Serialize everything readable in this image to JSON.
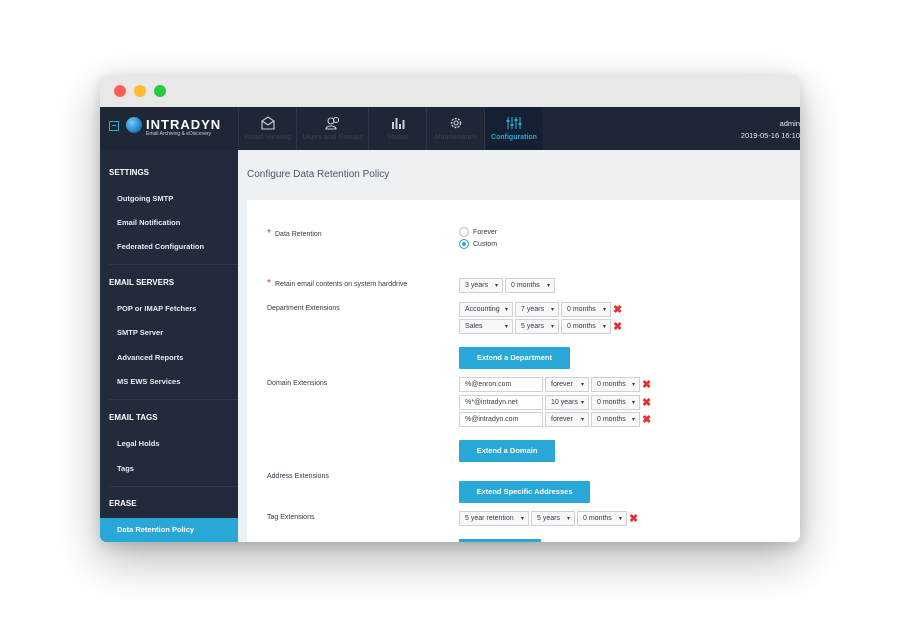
{
  "brand": {
    "name": "INTRADYN",
    "tagline": "Email Archiving & eDiscovery"
  },
  "nav": {
    "tabs": [
      {
        "label": "Email Viewing",
        "icon": "envelope-icon"
      },
      {
        "label": "Users and Groups",
        "icon": "users-icon"
      },
      {
        "label": "Status",
        "icon": "bar-chart-icon"
      },
      {
        "label": "Maintenance",
        "icon": "gear-icon"
      },
      {
        "label": "Configuration",
        "icon": "sliders-icon"
      }
    ],
    "active": "Configuration"
  },
  "user": {
    "name": "admin",
    "datetime": "2019-05-16 16:10"
  },
  "sidebar": {
    "sections": [
      {
        "title": "SETTINGS",
        "items": [
          "Outgoing SMTP",
          "Email Notification",
          "Federated Configuration"
        ]
      },
      {
        "title": "EMAIL SERVERS",
        "items": [
          "POP or IMAP Fetchers",
          "SMTP Server",
          "Advanced Reports",
          "MS EWS Services"
        ]
      },
      {
        "title": "EMAIL TAGS",
        "items": [
          "Legal Holds",
          "Tags"
        ]
      },
      {
        "title": "ERASE",
        "items": [
          "Data Retention Policy"
        ]
      }
    ],
    "active": "Data Retention Policy"
  },
  "page": {
    "title": "Configure Data Retention Policy",
    "data_retention": {
      "label": "Data Retention",
      "options": [
        "Forever",
        "Custom"
      ],
      "selected": "Custom"
    },
    "retain_contents": {
      "label": "Retain email contents on system harddrive",
      "years": "3 years",
      "months": "0 months"
    },
    "department_extensions": {
      "label": "Department Extensions",
      "rows": [
        {
          "name": "Accounting",
          "years": "7 years",
          "months": "0 months"
        },
        {
          "name": "Sales",
          "years": "5 years",
          "months": "0 months"
        }
      ],
      "button": "Extend a Department"
    },
    "domain_extensions": {
      "label": "Domain Extensions",
      "rows": [
        {
          "domain": "%@enron.com",
          "years": "forever",
          "months": "0 months"
        },
        {
          "domain": "%*@intradyn.net",
          "years": "10 years",
          "months": "0 months"
        },
        {
          "domain": "%@intradyn.com",
          "years": "forever",
          "months": "0 months"
        }
      ],
      "button": "Extend a Domain"
    },
    "address_extensions": {
      "label": "Address Extensions",
      "button": "Extend Specific Addresses"
    },
    "tag_extensions": {
      "label": "Tag Extensions",
      "rows": [
        {
          "tag": "5 year retention",
          "years": "5 years",
          "months": "0 months"
        }
      ]
    },
    "arrow_glyph": "▾",
    "remove_glyph": "✖",
    "required_glyph": "*"
  }
}
